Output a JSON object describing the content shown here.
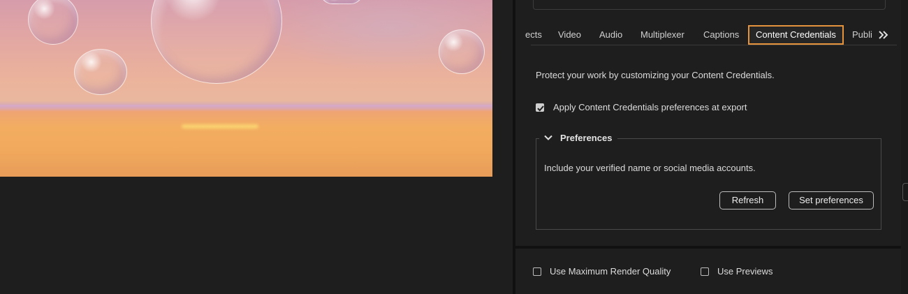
{
  "tabs": {
    "items": [
      {
        "label": "ects"
      },
      {
        "label": "Video"
      },
      {
        "label": "Audio"
      },
      {
        "label": "Multiplexer"
      },
      {
        "label": "Captions"
      },
      {
        "label": "Content Credentials",
        "active": true
      },
      {
        "label": "Publi"
      }
    ],
    "overflow_icon": "double-chevron-right-icon"
  },
  "content_credentials": {
    "description": "Protect your work by customizing your Content Credentials.",
    "apply_checkbox": {
      "label": "Apply Content Credentials preferences at export",
      "checked": true
    },
    "preferences": {
      "title": "Preferences",
      "expanded": true,
      "text": "Include your verified name or social media accounts.",
      "refresh_label": "Refresh",
      "set_label": "Set preferences"
    }
  },
  "footer": {
    "max_render": {
      "label": "Use Maximum Render Quality",
      "checked": false
    },
    "use_previews": {
      "label": "Use Previews",
      "checked": false
    }
  },
  "colors": {
    "active_tab_outline": "#e5943d",
    "panel_background": "#1e1e1e"
  }
}
